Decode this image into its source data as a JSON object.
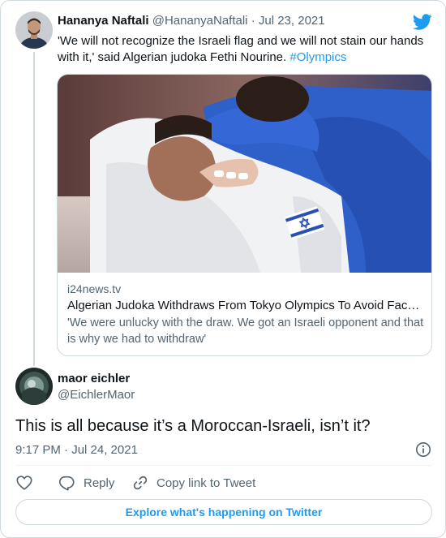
{
  "quoted_tweet": {
    "author_name": "Hananya Naftali",
    "author_handle": "@HananyaNaftali",
    "separator": " · ",
    "date": "Jul 23, 2021",
    "text": "'We will not recognize the Israeli flag and we will not stain our hands with it,' said Algerian judoka Fethi Nourine. ",
    "hashtag": "#Olympics",
    "link_card": {
      "domain": "i24news.tv",
      "title": "Algerian Judoka Withdraws From Tokyo Olympics To Avoid Fac…",
      "description": "'We were unlucky with the draw. We got an Israeli opponent and that is why we had to withdraw'",
      "image_icon": "judo-photo"
    }
  },
  "reply_tweet": {
    "author_name": "maor eichler",
    "author_handle": "@EichlerMaor",
    "text": "This is all because it’s a Moroccan-Israeli, isn’t it?",
    "timestamp": "9:17 PM · Jul 24, 2021"
  },
  "actions": {
    "like_icon": "heart-icon",
    "reply_label": "Reply",
    "copy_link_label": "Copy link to Tweet"
  },
  "explore_label": "Explore what's happening on Twitter",
  "colors": {
    "accent": "#1d9bf0",
    "text_primary": "#0f1419",
    "text_secondary": "#536471",
    "border": "#cfd9de"
  }
}
